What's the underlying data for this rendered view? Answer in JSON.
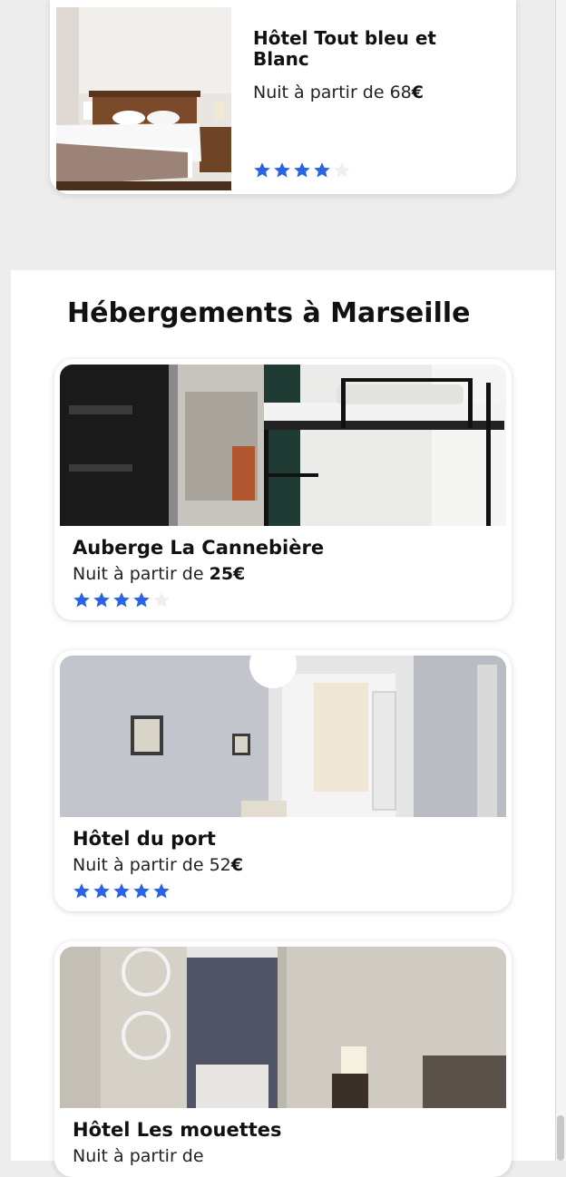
{
  "featured": {
    "name": "Hôtel Tout bleu et Blanc",
    "price_prefix": "Nuit à partir de 68",
    "price_currency": "€",
    "rating": 4,
    "max_rating": 5
  },
  "section": {
    "title": "Hébergements à Marseille"
  },
  "hotels": [
    {
      "name": "Auberge La Cannebière",
      "price_prefix": "Nuit à partir de ",
      "price_bold": "25€",
      "rating": 4
    },
    {
      "name": "Hôtel du port",
      "price_prefix": "Nuit à partir de 52",
      "price_bold": "€",
      "rating": 5
    },
    {
      "name": "Hôtel Les mouettes",
      "price_prefix": "Nuit à partir de ",
      "price_bold": "",
      "rating": 0
    }
  ],
  "colors": {
    "star_filled": "#2a63e4",
    "star_empty": "#efefef"
  }
}
